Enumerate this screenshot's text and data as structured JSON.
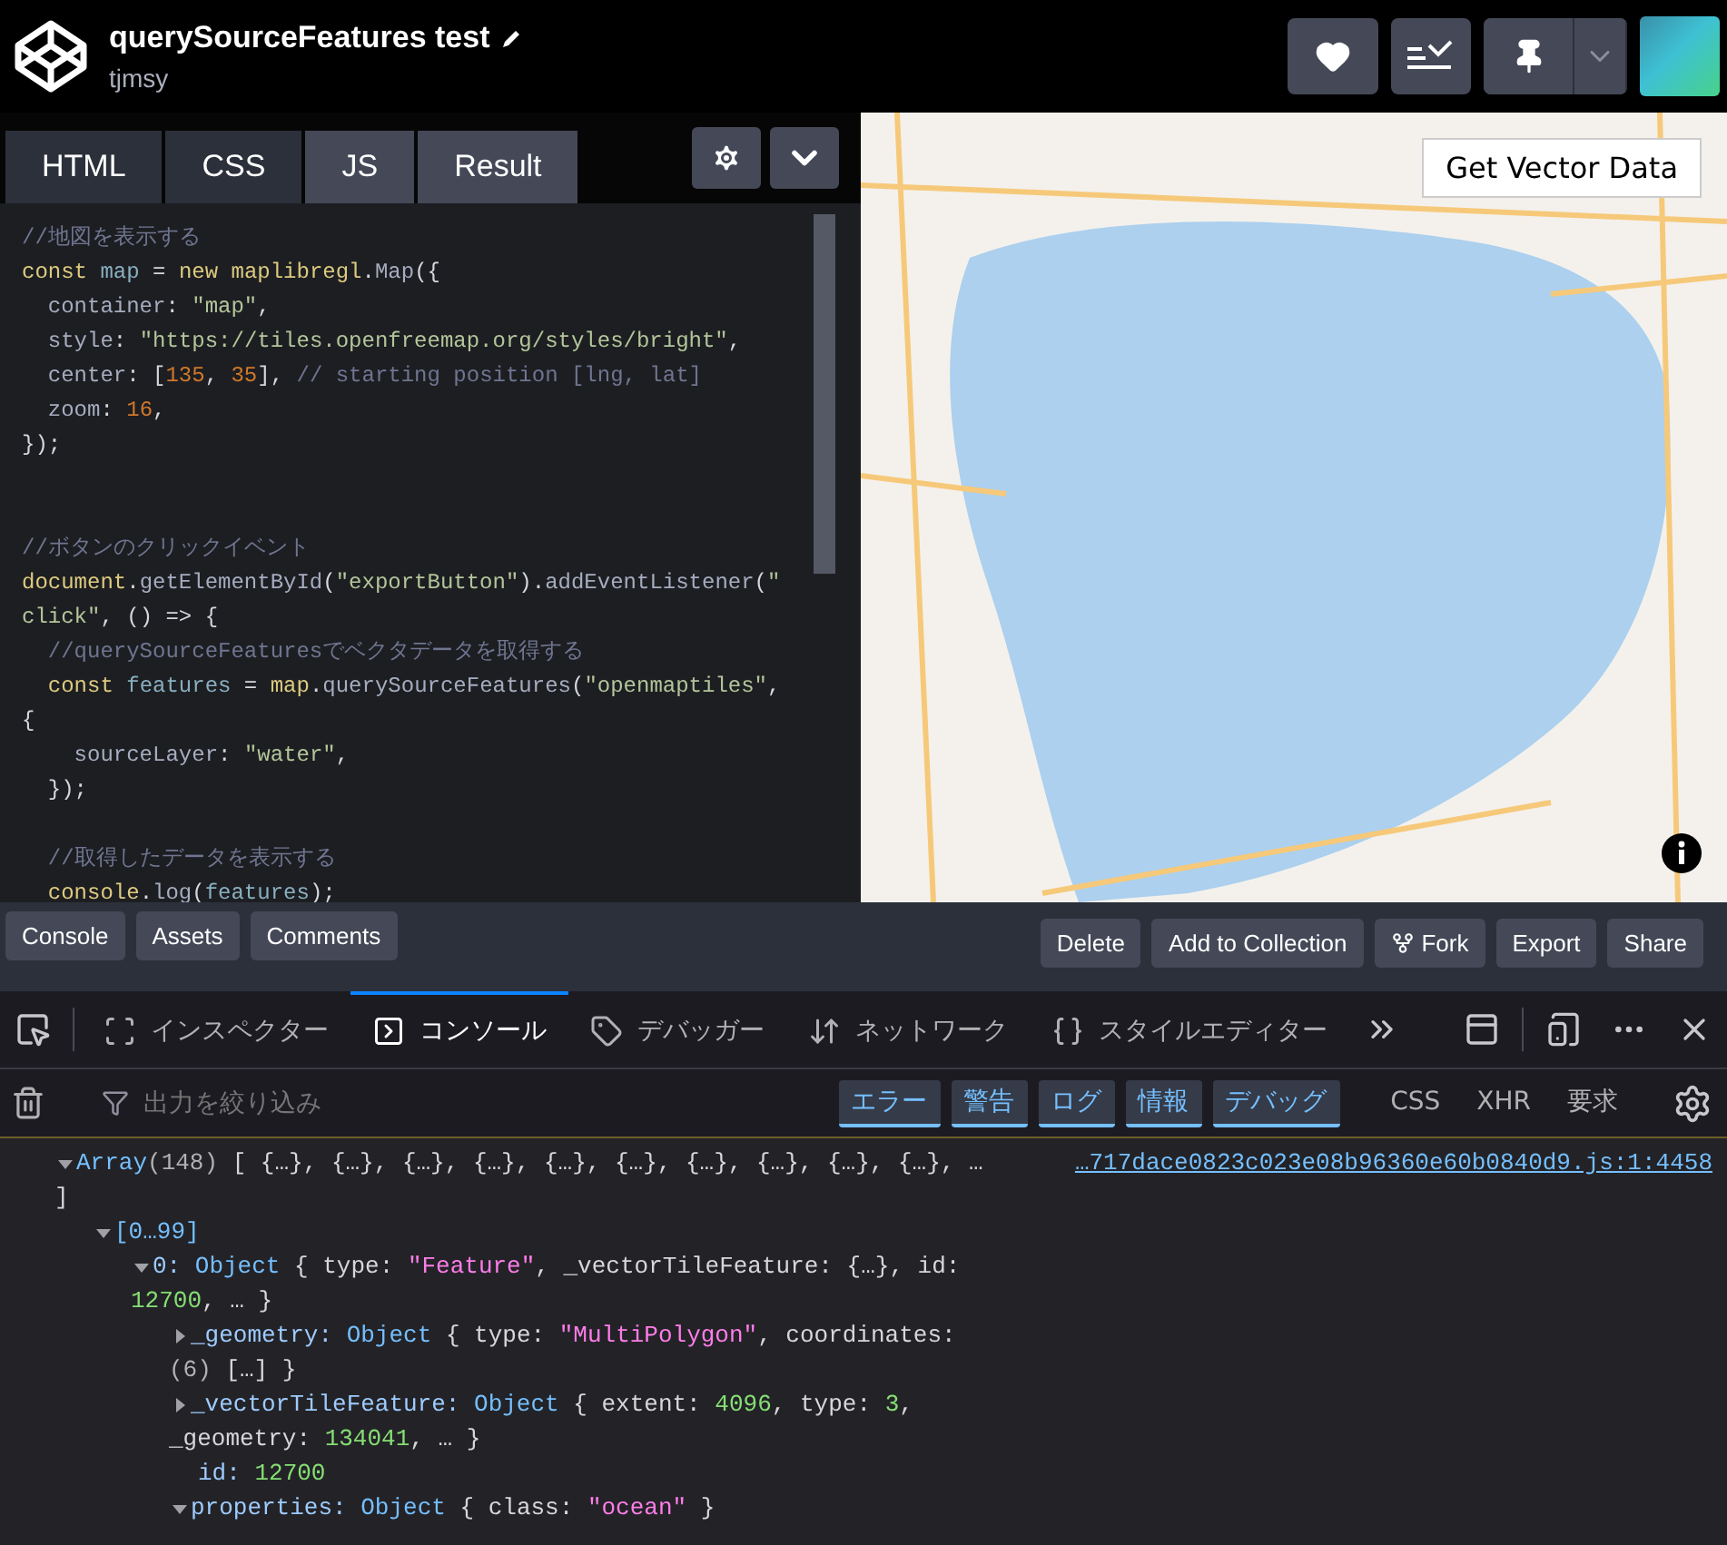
{
  "header": {
    "title": "querySourceFeatures test",
    "author": "tjmsy"
  },
  "editor": {
    "tabs": [
      {
        "label": "HTML",
        "selected": false
      },
      {
        "label": "CSS",
        "selected": false
      },
      {
        "label": "JS",
        "selected": true
      },
      {
        "label": "Result",
        "selected": true
      }
    ],
    "lines": [
      {
        "kind": "code",
        "tokens": [
          {
            "kind": "c",
            "text": "//地図を表示する"
          }
        ]
      },
      {
        "kind": "code",
        "tokens": [
          {
            "kind": "k",
            "text": "const"
          },
          {
            "kind": "v",
            "text": " map"
          },
          {
            "kind": "p",
            "text": " = "
          },
          {
            "kind": "k",
            "text": "new"
          },
          {
            "kind": "k",
            "text": " maplibregl"
          },
          {
            "kind": "p",
            "text": "."
          },
          {
            "kind": "f",
            "text": "Map"
          },
          {
            "kind": "p",
            "text": "({"
          }
        ]
      },
      {
        "kind": "code",
        "tokens": [
          {
            "kind": "f",
            "text": "  container"
          },
          {
            "kind": "p",
            "text": ": "
          },
          {
            "kind": "s",
            "text": "\"map\""
          },
          {
            "kind": "p",
            "text": ","
          }
        ]
      },
      {
        "kind": "code",
        "tokens": [
          {
            "kind": "f",
            "text": "  style"
          },
          {
            "kind": "p",
            "text": ": "
          },
          {
            "kind": "s",
            "text": "\"https://tiles.openfreemap.org/styles/bright\""
          },
          {
            "kind": "p",
            "text": ","
          }
        ]
      },
      {
        "kind": "code",
        "tokens": [
          {
            "kind": "f",
            "text": "  center"
          },
          {
            "kind": "p",
            "text": ": ["
          },
          {
            "kind": "n",
            "text": "135"
          },
          {
            "kind": "p",
            "text": ", "
          },
          {
            "kind": "n",
            "text": "35"
          },
          {
            "kind": "p",
            "text": "], "
          },
          {
            "kind": "c",
            "text": "// starting position [lng, lat]"
          }
        ]
      },
      {
        "kind": "code",
        "tokens": [
          {
            "kind": "f",
            "text": "  zoom"
          },
          {
            "kind": "p",
            "text": ": "
          },
          {
            "kind": "n",
            "text": "16"
          },
          {
            "kind": "p",
            "text": ","
          }
        ]
      },
      {
        "kind": "code",
        "tokens": [
          {
            "kind": "p",
            "text": "});"
          }
        ]
      },
      {
        "kind": "blank"
      },
      {
        "kind": "blank"
      },
      {
        "kind": "code",
        "tokens": [
          {
            "kind": "c",
            "text": "//ボタンのクリックイベント"
          }
        ]
      },
      {
        "kind": "code",
        "tokens": [
          {
            "kind": "k",
            "text": "document"
          },
          {
            "kind": "p",
            "text": "."
          },
          {
            "kind": "f",
            "text": "getElementById"
          },
          {
            "kind": "p",
            "text": "("
          },
          {
            "kind": "s",
            "text": "\"exportButton\""
          },
          {
            "kind": "p",
            "text": ")."
          },
          {
            "kind": "f",
            "text": "addEventListener"
          },
          {
            "kind": "p",
            "text": "("
          },
          {
            "kind": "s",
            "text": "\""
          }
        ]
      },
      {
        "kind": "code",
        "tokens": [
          {
            "kind": "s",
            "text": "click\""
          },
          {
            "kind": "p",
            "text": ", () => {"
          }
        ]
      },
      {
        "kind": "code",
        "tokens": [
          {
            "kind": "c",
            "text": "  //querySourceFeaturesでベクタデータを取得する"
          }
        ]
      },
      {
        "kind": "code",
        "tokens": [
          {
            "kind": "k",
            "text": "  const"
          },
          {
            "kind": "v",
            "text": " features"
          },
          {
            "kind": "p",
            "text": " = "
          },
          {
            "kind": "k",
            "text": "map"
          },
          {
            "kind": "p",
            "text": "."
          },
          {
            "kind": "f",
            "text": "querySourceFeatures"
          },
          {
            "kind": "p",
            "text": "("
          },
          {
            "kind": "s",
            "text": "\"openmaptiles\""
          },
          {
            "kind": "p",
            "text": ","
          }
        ]
      },
      {
        "kind": "code",
        "tokens": [
          {
            "kind": "p",
            "text": "{"
          }
        ]
      },
      {
        "kind": "code",
        "tokens": [
          {
            "kind": "f",
            "text": "    sourceLayer"
          },
          {
            "kind": "p",
            "text": ": "
          },
          {
            "kind": "s",
            "text": "\"water\""
          },
          {
            "kind": "p",
            "text": ","
          }
        ]
      },
      {
        "kind": "code",
        "tokens": [
          {
            "kind": "p",
            "text": "  });"
          }
        ]
      },
      {
        "kind": "blank"
      },
      {
        "kind": "code",
        "tokens": [
          {
            "kind": "c",
            "text": "  //取得したデータを表示する"
          }
        ]
      },
      {
        "kind": "code",
        "tokens": [
          {
            "kind": "k",
            "text": "  console"
          },
          {
            "kind": "p",
            "text": "."
          },
          {
            "kind": "f",
            "text": "log"
          },
          {
            "kind": "p",
            "text": "("
          },
          {
            "kind": "v",
            "text": "features"
          },
          {
            "kind": "p",
            "text": ");"
          }
        ]
      }
    ]
  },
  "map": {
    "button": "Get Vector Data"
  },
  "bottom_bar": {
    "left_buttons": [
      "Console",
      "Assets",
      "Comments"
    ],
    "right_buttons": [
      {
        "label": "Delete",
        "kind": "plain"
      },
      {
        "label": "Add to Collection",
        "kind": "plain"
      },
      {
        "label": "Fork",
        "kind": "fork"
      },
      {
        "label": "Export",
        "kind": "plain"
      },
      {
        "label": "Share",
        "kind": "plain"
      }
    ]
  },
  "devtools": {
    "tabs": [
      {
        "label": "インスペクター",
        "selected": false
      },
      {
        "label": "コンソール",
        "selected": true
      },
      {
        "label": "デバッガー",
        "selected": false
      },
      {
        "label": "ネットワーク",
        "selected": false
      },
      {
        "label": "スタイルエディター",
        "selected": false
      }
    ],
    "filter": {
      "placeholder": "出力を絞り込み"
    },
    "levels": [
      {
        "label": "エラー",
        "selected": true
      },
      {
        "label": "警告",
        "selected": true
      },
      {
        "label": "ログ",
        "selected": true
      },
      {
        "label": "情報",
        "selected": true
      },
      {
        "label": "デバッグ",
        "selected": true
      }
    ],
    "categories": [
      {
        "label": "CSS",
        "selected": false
      },
      {
        "label": "XHR",
        "selected": false
      },
      {
        "label": "要求",
        "selected": false
      }
    ],
    "output": [
      {
        "kind": "branch",
        "expanded": true,
        "source": "…717dace0823c023e08b96360e60b0840d9.js:1:4458",
        "lines": [
          [
            {
              "kind": "o",
              "text": "Array"
            },
            {
              "kind": "g",
              "text": "(148)"
            },
            {
              "kind": "p",
              "text": " [ {…}, {…}, {…}, {…}, {…}, {…}, {…}, {…}, {…}, {…}, …"
            }
          ],
          [
            {
              "kind": "p",
              "text": "]"
            }
          ]
        ],
        "children": [
          {
            "kind": "branch",
            "expanded": true,
            "lines": [
              [
                {
                  "kind": "o",
                  "text": "[0…99]"
                }
              ]
            ],
            "children": [
              {
                "kind": "branch",
                "expanded": true,
                "lines": [
                  [
                    {
                      "kind": "k",
                      "text": "0: "
                    },
                    {
                      "kind": "o",
                      "text": "Object"
                    },
                    {
                      "kind": "p",
                      "text": " { type: "
                    },
                    {
                      "kind": "s",
                      "text": "\"Feature\""
                    },
                    {
                      "kind": "p",
                      "text": ", _vectorTileFeature: {…}, id:"
                    }
                  ],
                  [
                    {
                      "kind": "n",
                      "text": "12700"
                    },
                    {
                      "kind": "p",
                      "text": ", … }"
                    }
                  ]
                ],
                "children": [
                  {
                    "kind": "branch",
                    "expanded": false,
                    "lines": [
                      [
                        {
                          "kind": "k",
                          "text": "_geometry: "
                        },
                        {
                          "kind": "o",
                          "text": "Object"
                        },
                        {
                          "kind": "p",
                          "text": " { type: "
                        },
                        {
                          "kind": "s",
                          "text": "\"MultiPolygon\""
                        },
                        {
                          "kind": "p",
                          "text": ", coordinates:"
                        }
                      ],
                      [
                        {
                          "kind": "g",
                          "text": "(6)"
                        },
                        {
                          "kind": "p",
                          "text": " […] }"
                        }
                      ]
                    ]
                  },
                  {
                    "kind": "branch",
                    "expanded": false,
                    "lines": [
                      [
                        {
                          "kind": "k",
                          "text": "_vectorTileFeature: "
                        },
                        {
                          "kind": "o",
                          "text": "Object"
                        },
                        {
                          "kind": "p",
                          "text": " { extent: "
                        },
                        {
                          "kind": "n",
                          "text": "4096"
                        },
                        {
                          "kind": "p",
                          "text": ", type: "
                        },
                        {
                          "kind": "n",
                          "text": "3"
                        },
                        {
                          "kind": "p",
                          "text": ","
                        }
                      ],
                      [
                        {
                          "kind": "p",
                          "text": "_geometry: "
                        },
                        {
                          "kind": "n",
                          "text": "134041"
                        },
                        {
                          "kind": "p",
                          "text": ", … }"
                        }
                      ]
                    ]
                  },
                  {
                    "kind": "leaf",
                    "lines": [
                      [
                        {
                          "kind": "k",
                          "text": "id: "
                        },
                        {
                          "kind": "n",
                          "text": "12700"
                        }
                      ]
                    ]
                  },
                  {
                    "kind": "branch",
                    "expanded": true,
                    "lines": [
                      [
                        {
                          "kind": "k",
                          "text": "properties: "
                        },
                        {
                          "kind": "o",
                          "text": "Object"
                        },
                        {
                          "kind": "p",
                          "text": " { class: "
                        },
                        {
                          "kind": "s",
                          "text": "\"ocean\""
                        },
                        {
                          "kind": "p",
                          "text": " }"
                        }
                      ]
                    ]
                  }
                ]
              }
            ]
          }
        ]
      }
    ]
  }
}
